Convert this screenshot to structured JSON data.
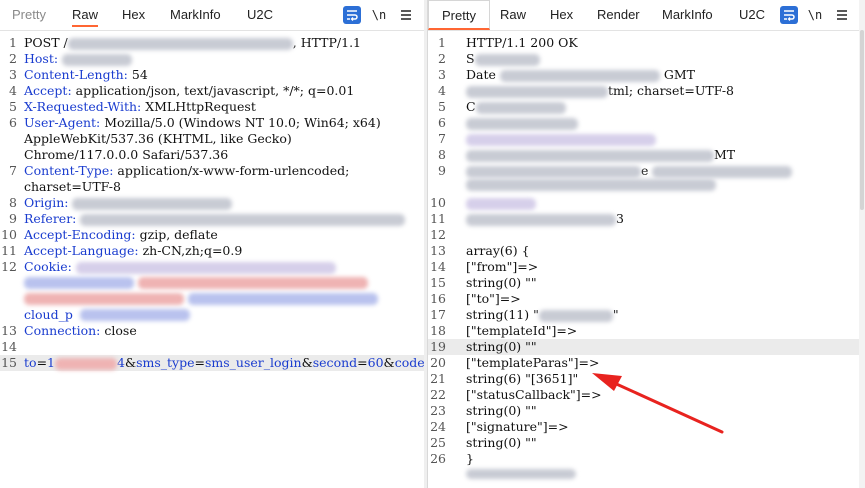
{
  "left": {
    "tabs": [
      "Pretty",
      "Raw",
      "Hex",
      "MarkInfo",
      "U2C"
    ],
    "active_tab": "Raw",
    "icons": [
      "wrap-lines-icon",
      "newline-toggle-icon",
      "menu-icon"
    ],
    "newline_label": "\\n",
    "lines": {
      "n1": "1",
      "l1_a": "POST /",
      "l1_b": ", HTTP/1.1",
      "n2": "2",
      "l2_k": "Host:",
      "n3": "3",
      "l3_k": "Content-Length:",
      "l3_v": " 54",
      "n4": "4",
      "l4_k": "Accept:",
      "l4_v": " application/json, text/javascript, */*; q=0.01",
      "n5": "5",
      "l5_k": "X-Requested-With:",
      "l5_v": " XMLHttpRequest",
      "n6": "6",
      "l6_k": "User-Agent:",
      "l6_v": " Mozilla/5.0 (Windows NT 10.0; Win64; x64)",
      "l6_c1": "AppleWebKit/537.36 (KHTML, like Gecko)",
      "l6_c2": "Chrome/117.0.0.0 Safari/537.36",
      "n7": "7",
      "l7_k": "Content-Type:",
      "l7_v": " application/x-www-form-urlencoded;",
      "l7_c1": "charset=UTF-8",
      "n8": "8",
      "l8_k": "Origin:",
      "n9": "9",
      "l9_k": "Referer:",
      "n10": "10",
      "l10_k": "Accept-Encoding:",
      "l10_v": " gzip, deflate",
      "n11": "11",
      "l11_k": "Accept-Language:",
      "l11_v": " zh-CN,zh;q=0.9",
      "n12": "12",
      "l12_k": "Cookie:",
      "l12_c4": "cloud_p",
      "n13": "13",
      "l13_k": "Connection:",
      "l13_v": " close",
      "n14": "14",
      "n15": "15",
      "l15_p1": "to",
      "l15_v1a": "1",
      "l15_v1b": "4",
      "l15_p2": "sms_type",
      "l15_v2": "sms_user_login",
      "l15_p3": "second",
      "l15_v3": "60",
      "l15_p4": "code"
    }
  },
  "right": {
    "tabs": [
      "Pretty",
      "Raw",
      "Hex",
      "Render",
      "MarkInfo",
      "U2C"
    ],
    "active_tab": "Pretty",
    "icons": [
      "wrap-lines-icon",
      "newline-toggle-icon",
      "menu-icon"
    ],
    "newline_label": "\\n",
    "lines": {
      "n1": "1",
      "l1": "HTTP/1.1 200 OK",
      "n2": "2",
      "l2": "S",
      "n3": "3",
      "l3_a": "Date",
      "l3_b": "GMT",
      "n4": "4",
      "l4_b": "tml; charset=UTF-8",
      "n5": "5",
      "l5": "C",
      "n6": "6",
      "n7": "7",
      "n8": "8",
      "l8_b": "MT",
      "n9": "9",
      "l9_b": "e",
      "n10": "10",
      "n11": "11",
      "l11_b": "3",
      "n12": "12",
      "n13": "13",
      "l13": "array(6) {",
      "n14": "14",
      "l14": "[\"from\"]=>",
      "n15": "15",
      "l15": "string(0) \"\"",
      "n16": "16",
      "l16": "[\"to\"]=>",
      "n17": "17",
      "l17_a": "string(11) \"",
      "l17_b": "\"",
      "n18": "18",
      "l18": "[\"templateId\"]=>",
      "n19": "19",
      "l19": "string(0) \"\"",
      "n20": "20",
      "l20": "[\"templateParas\"]=>",
      "n21": "21",
      "l21": "string(6) \"[3651]\"",
      "n22": "22",
      "l22": "[\"statusCallback\"]=>",
      "n23": "23",
      "l23": "string(0) \"\"",
      "n24": "24",
      "l24": "[\"signature\"]=>",
      "n25": "25",
      "l25": "string(0) \"\"",
      "n26": "26",
      "l26": "}"
    }
  },
  "annotation": {
    "arrow_color": "#e8231f"
  }
}
